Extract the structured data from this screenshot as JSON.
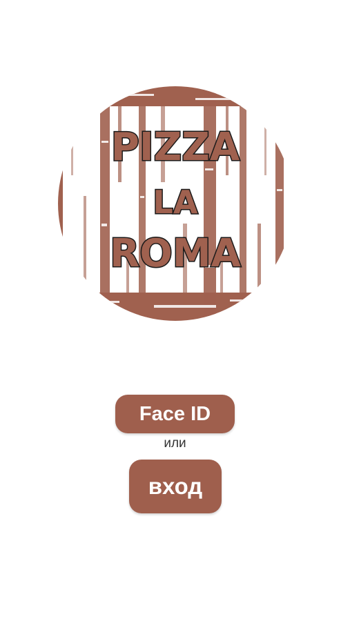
{
  "logo": {
    "line1": "PIZZA",
    "line2": "LA",
    "line3": "ROMA",
    "color": "#a0614f"
  },
  "auth": {
    "faceid_label": "Face ID",
    "or_label": "или",
    "login_label": "вход",
    "button_color": "#9f5f4d"
  }
}
